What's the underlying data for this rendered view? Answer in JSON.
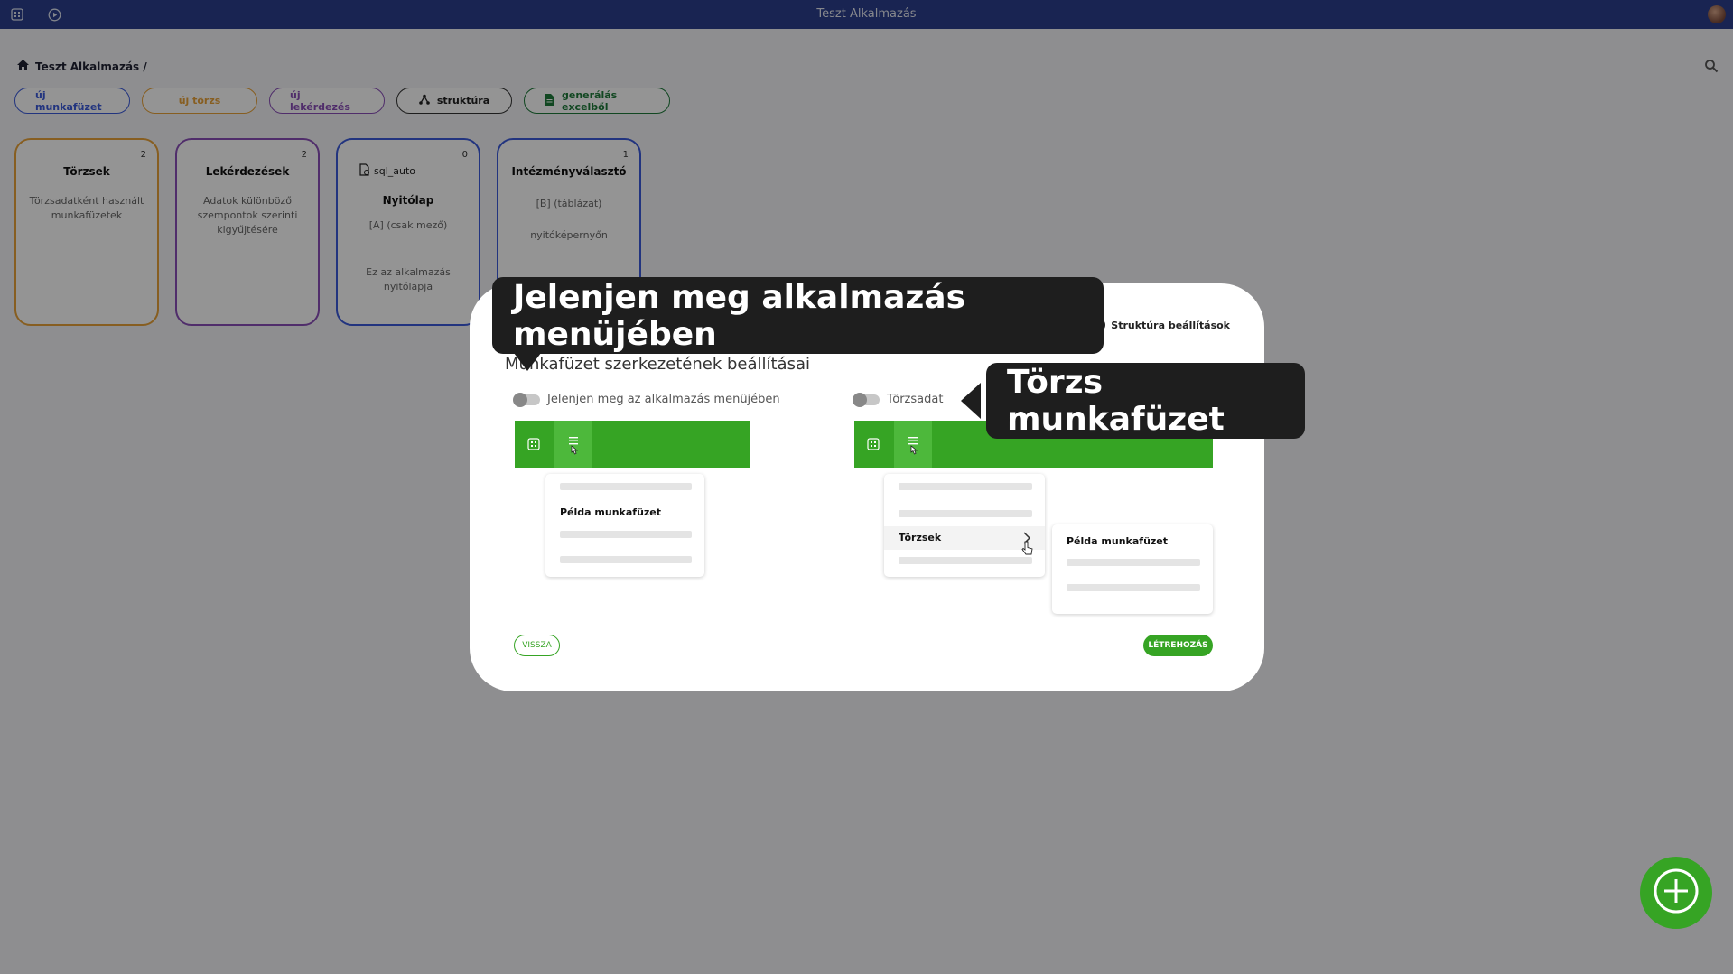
{
  "app": {
    "title": "Teszt Alkalmazás"
  },
  "breadcrumb": {
    "label": "Teszt Alkalmazás /"
  },
  "actions": {
    "new_workbook": "új munkafüzet",
    "new_master": "új törzs",
    "new_query": "új lekérdezés",
    "structure": "struktúra",
    "generate_excel": "generálás excelből"
  },
  "cards": [
    {
      "count": "2",
      "title": "Törzsek",
      "desc": "Törzsadatként használt munkafüzetek"
    },
    {
      "count": "2",
      "title": "Lekérdezések",
      "desc": "Adatok különböző szempontok szerinti kigyűjtésére"
    },
    {
      "count": "0",
      "tag": "sql_auto",
      "title": "Nyitólap",
      "line1": "[A] (csak mező)",
      "desc": "Ez az alkalmazás nyitólapja"
    },
    {
      "count": "1",
      "title": "Intézményválasztó",
      "line1": "[B] (táblázat)",
      "line2": "nyitóképernyőn"
    }
  ],
  "modal": {
    "step_number": "3",
    "step_label": "Struktúra beállítások",
    "title": "Munkafüzet szerkezetének beállításai",
    "toggle_menu_label": "Jelenjen meg az alkalmazás menüjében",
    "toggle_master_label": "Törzsadat",
    "example_workbook": "Példa munkafüzet",
    "masters_item": "Törzsek",
    "back_label": "VISSZA",
    "create_label": "LÉTREHOZÁS"
  },
  "tooltips": {
    "menu": "Jelenjen meg alkalmazás menüjében",
    "master": "Törzs munkafüzet"
  },
  "colors": {
    "topbar": "#2b3f8e",
    "accent_green": "#36a424",
    "btn_blue": "#3b5bdb",
    "btn_orange": "#e8a33a",
    "btn_purple": "#8a4fb8",
    "btn_green": "#1e7a3a"
  },
  "icons": [
    "grid-icon",
    "play-circle-icon",
    "home-icon",
    "search-icon",
    "structure-icon",
    "sheet-icon",
    "sql-file-icon",
    "menu-icon",
    "hand-pointer-icon",
    "chevron-right-icon",
    "plus-circle-icon"
  ]
}
